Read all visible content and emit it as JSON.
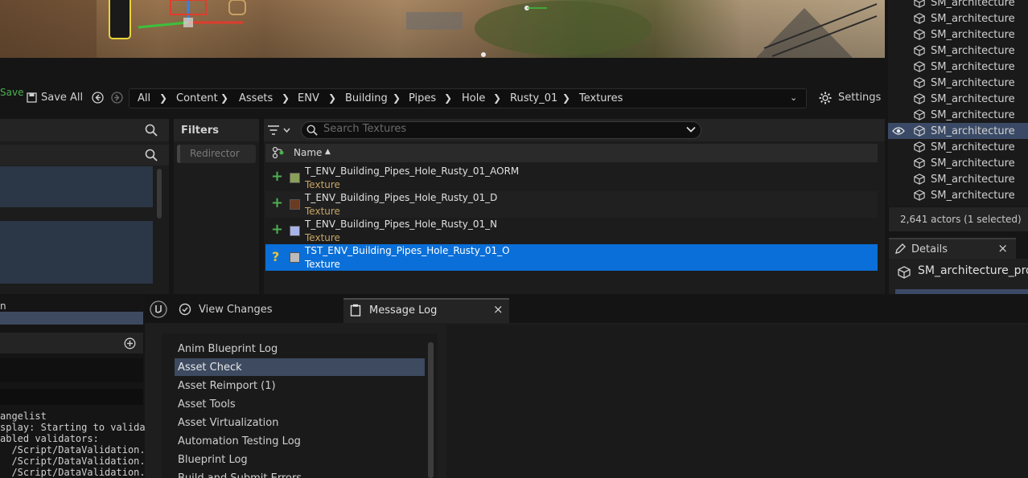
{
  "toolbar": {
    "save_label": "Save",
    "save_all_label": "Save All",
    "settings_label": "Settings",
    "breadcrumb": [
      "All",
      "Content",
      "Assets",
      "ENV",
      "Building",
      "Pipes",
      "Hole",
      "Rusty_01",
      "Textures"
    ]
  },
  "filters": {
    "title": "Filters",
    "chip": "Redirector"
  },
  "asset_browser": {
    "search_placeholder": "Search Textures",
    "column_name": "Name",
    "assets": [
      {
        "name": "T_ENV_Building_Pipes_Hole_Rusty_01_AORM",
        "type": "Texture",
        "status": "plus",
        "thumb_color": "#8aa05a"
      },
      {
        "name": "T_ENV_Building_Pipes_Hole_Rusty_01_D",
        "type": "Texture",
        "status": "plus",
        "thumb_color": "#6b3a22"
      },
      {
        "name": "T_ENV_Building_Pipes_Hole_Rusty_01_N",
        "type": "Texture",
        "status": "plus",
        "thumb_color": "#a8b4e8"
      },
      {
        "name": "TST_ENV_Building_Pipes_Hole_Rusty_01_O",
        "type": "Texture",
        "status": "question",
        "thumb_color": "#bbbbbb"
      }
    ]
  },
  "outliner": {
    "items": [
      "SM_architecture",
      "SM_architecture",
      "SM_architecture",
      "SM_architecture",
      "SM_architecture",
      "SM_architecture",
      "SM_architecture",
      "SM_architecture",
      "SM_architecture",
      "SM_architecture",
      "SM_architecture",
      "SM_architecture",
      "SM_architecture"
    ],
    "selected_index": 8,
    "actor_count": "2,641 actors (1 selected)"
  },
  "details": {
    "tab_label": "Details",
    "object_name": "SM_architecture_pro"
  },
  "bottom_tabs": {
    "view_changes": "View Changes",
    "message_log": "Message Log"
  },
  "message_log": {
    "categories": [
      "Anim Blueprint Log",
      "Asset Check",
      "Asset Reimport (1)",
      "Asset Tools",
      "Asset Virtualization",
      "Automation Testing Log",
      "Blueprint Log",
      "Build and Submit Errors"
    ],
    "selected_index": 1
  },
  "left_panel": {
    "partial_label": "n",
    "log_lines": [
      "angelist",
      "splay: Starting to validat",
      "abled validators:",
      "  /Script/DataValidation.D",
      "  /Script/DataValidation.E",
      "  /Script/DataValidation.W"
    ]
  },
  "colors": {
    "selection_blue": "#0a6fd8",
    "save_green": "#4caf50",
    "texture_type": "#c8a464"
  }
}
